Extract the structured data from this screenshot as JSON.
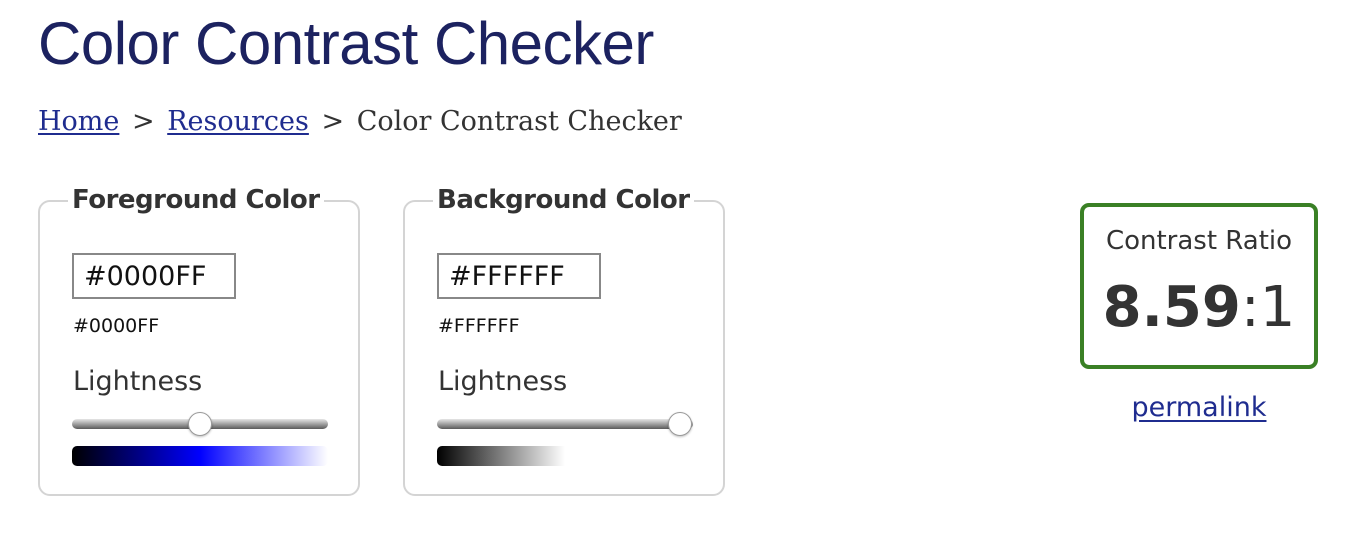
{
  "page": {
    "title": "Color Contrast Checker"
  },
  "breadcrumb": {
    "home": "Home",
    "resources": "Resources",
    "current": "Color Contrast Checker",
    "separator": ">"
  },
  "foreground": {
    "legend": "Foreground Color",
    "input_value": "#0000FF",
    "hex_readout": "#0000FF",
    "lightness_label": "Lightness",
    "lightness_fraction": 0.5,
    "color": "#0000FF"
  },
  "background": {
    "legend": "Background Color",
    "input_value": "#FFFFFF",
    "hex_readout": "#FFFFFF",
    "lightness_label": "Lightness",
    "lightness_fraction": 0.95,
    "color": "#FFFFFF"
  },
  "contrast": {
    "label": "Contrast Ratio",
    "value": "8.59",
    "suffix": ":1",
    "border_color": "#3A8025"
  },
  "permalink": {
    "label": "permalink"
  },
  "colors": {
    "title": "#1C2260",
    "link": "#1F2C8F",
    "panel_border": "#D4D4D4",
    "text": "#333333"
  }
}
